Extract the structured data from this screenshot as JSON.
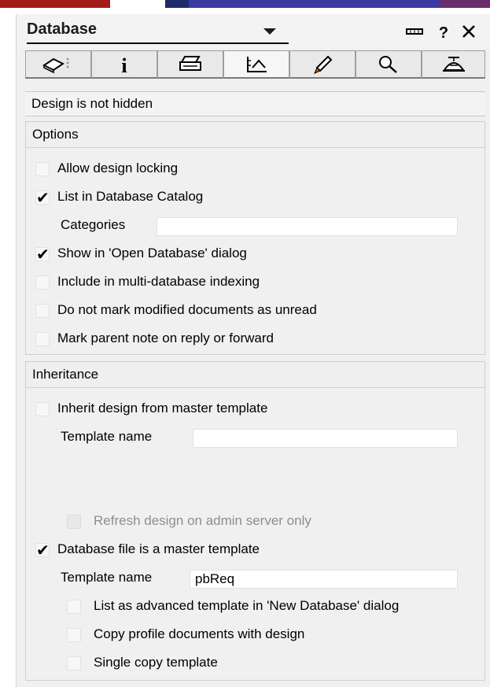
{
  "window": {
    "title": "Database"
  },
  "tabs": [
    {
      "name": "basics-tab",
      "icon": "database-basics-icon"
    },
    {
      "name": "info-tab",
      "icon": "info-icon"
    },
    {
      "name": "print-tab",
      "icon": "printer-icon"
    },
    {
      "name": "design-tab",
      "icon": "design-ruler-icon",
      "active": true
    },
    {
      "name": "launch-tab",
      "icon": "rocket-icon"
    },
    {
      "name": "search-tab",
      "icon": "magnifier-icon"
    },
    {
      "name": "advanced-tab",
      "icon": "propeller-hat-icon"
    }
  ],
  "status": {
    "text": "Design is not hidden"
  },
  "options": {
    "header": "Options",
    "allow_design_locking": {
      "label": "Allow design locking",
      "checked": false
    },
    "list_in_catalog": {
      "label": "List in Database Catalog",
      "checked": true
    },
    "categories": {
      "label": "Categories",
      "value": ""
    },
    "show_in_open_dialog": {
      "label": "Show in 'Open Database' dialog",
      "checked": true
    },
    "multi_db_indexing": {
      "label": "Include in multi-database indexing",
      "checked": false
    },
    "do_not_mark_unread": {
      "label": "Do not mark modified documents as unread",
      "checked": false
    },
    "mark_parent_note": {
      "label": "Mark parent note on reply or forward",
      "checked": false
    }
  },
  "inheritance": {
    "header": "Inheritance",
    "inherit_design": {
      "label": "Inherit design from master template",
      "checked": false
    },
    "inherit_template_name": {
      "label": "Template name",
      "value": ""
    },
    "refresh_on_admin": {
      "label": "Refresh design on admin server only",
      "checked": false,
      "disabled": true
    },
    "is_master_template": {
      "label": "Database file is a master template",
      "checked": true
    },
    "master_template_name": {
      "label": "Template name",
      "value": "pbReq"
    },
    "list_as_advanced": {
      "label": "List as advanced template in 'New Database' dialog",
      "checked": false
    },
    "copy_profile_docs": {
      "label": "Copy profile documents with design",
      "checked": false
    },
    "single_copy": {
      "label": "Single copy template",
      "checked": false
    }
  }
}
